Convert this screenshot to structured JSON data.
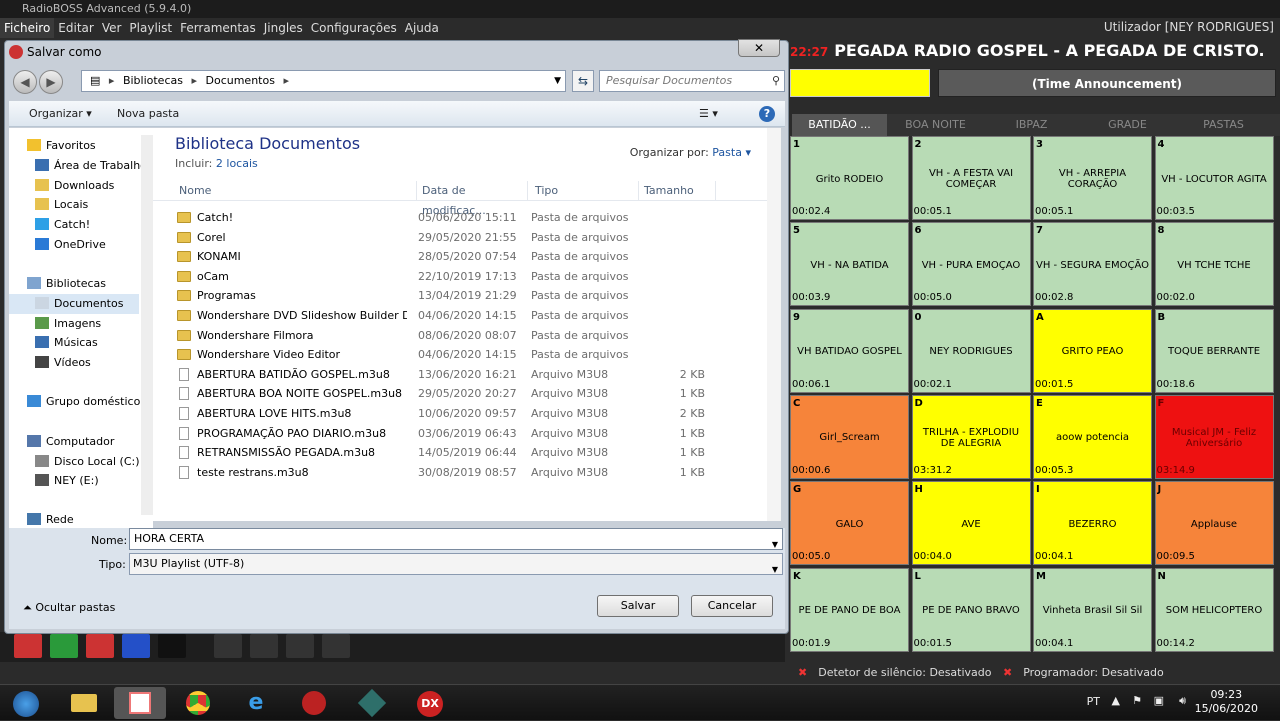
{
  "app": {
    "title": "RadioBOSS Advanced (5.9.4.0)",
    "user": "Utilizador [NEY RODRIGUES]",
    "menu": [
      "Ficheiro",
      "Editar",
      "Ver",
      "Playlist",
      "Ferramentas",
      "Jingles",
      "Configurações",
      "Ajuda"
    ],
    "now_time": "22:27",
    "now_playing": "PEGADA RADIO GOSPEL -  A PEGADA DE CRISTO.",
    "time_announcement": "(Time Announcement)",
    "tabs": [
      "BATIDÃO ...",
      "BOA NOITE",
      "IBPAZ",
      "GRADE",
      "PASTAS"
    ],
    "status": [
      "Detetor de silêncio: Desativado",
      "Programador: Desativado"
    ]
  },
  "jingles": [
    {
      "key": "1",
      "title": "Grito RODEIO",
      "dur": "00:02.4",
      "color": "#b8dbb5"
    },
    {
      "key": "2",
      "title": "VH - A FESTA VAI COMEÇAR",
      "dur": "00:05.1",
      "color": "#b8dbb5"
    },
    {
      "key": "3",
      "title": "VH - ARREPIA CORAÇÃO",
      "dur": "00:05.1",
      "color": "#b8dbb5"
    },
    {
      "key": "4",
      "title": "VH - LOCUTOR AGITA",
      "dur": "00:03.5",
      "color": "#b8dbb5"
    },
    {
      "key": "5",
      "title": "VH - NA BATIDA",
      "dur": "00:03.9",
      "color": "#b8dbb5"
    },
    {
      "key": "6",
      "title": "VH - PURA EMOÇAO",
      "dur": "00:05.0",
      "color": "#b8dbb5"
    },
    {
      "key": "7",
      "title": "VH - SEGURA EMOÇÃO",
      "dur": "00:02.8",
      "color": "#b8dbb5"
    },
    {
      "key": "8",
      "title": "VH TCHE TCHE",
      "dur": "00:02.0",
      "color": "#b8dbb5"
    },
    {
      "key": "9",
      "title": "VH BATIDAO GOSPEL",
      "dur": "00:06.1",
      "color": "#b8dbb5"
    },
    {
      "key": "0",
      "title": "NEY RODRIGUES",
      "dur": "00:02.1",
      "color": "#b8dbb5"
    },
    {
      "key": "A",
      "title": "GRITO PEAO",
      "dur": "00:01.5",
      "color": "#ffff00"
    },
    {
      "key": "B",
      "title": "TOQUE BERRANTE",
      "dur": "00:18.6",
      "color": "#b8dbb5"
    },
    {
      "key": "C",
      "title": "Girl_Scream",
      "dur": "00:00.6",
      "color": "#f6843a"
    },
    {
      "key": "D",
      "title": "TRILHA - EXPLODIU DE ALEGRIA",
      "dur": "03:31.2",
      "color": "#ffff00"
    },
    {
      "key": "E",
      "title": "aoow potencia",
      "dur": "00:05.3",
      "color": "#ffff00"
    },
    {
      "key": "F",
      "title": "Musical JM - Feliz Aniversário",
      "dur": "03:14.9",
      "color": "#ee1111"
    },
    {
      "key": "G",
      "title": "GALO",
      "dur": "00:05.0",
      "color": "#f6843a"
    },
    {
      "key": "H",
      "title": "AVE",
      "dur": "00:04.0",
      "color": "#ffff00"
    },
    {
      "key": "I",
      "title": "BEZERRO",
      "dur": "00:04.1",
      "color": "#ffff00"
    },
    {
      "key": "J",
      "title": "Applause",
      "dur": "00:09.5",
      "color": "#f6843a"
    },
    {
      "key": "K",
      "title": "PE DE PANO DE BOA",
      "dur": "00:01.9",
      "color": "#b8dbb5"
    },
    {
      "key": "L",
      "title": "PE DE PANO BRAVO",
      "dur": "00:01.5",
      "color": "#b8dbb5"
    },
    {
      "key": "M",
      "title": "Vinheta Brasil Sil Sil",
      "dur": "00:04.1",
      "color": "#b8dbb5"
    },
    {
      "key": "N",
      "title": "SOM HELICOPTERO",
      "dur": "00:14.2",
      "color": "#b8dbb5"
    }
  ],
  "dialog": {
    "title": "Salvar como",
    "address": [
      "Bibliotecas",
      "Documentos"
    ],
    "search_placeholder": "Pesquisar Documentos",
    "organize": "Organizar",
    "new_folder": "Nova pasta",
    "nav": [
      {
        "label": "Favoritos",
        "icon": "star-icon"
      },
      {
        "label": "Área de Trabalho",
        "icon": "desktop-icon"
      },
      {
        "label": "Downloads",
        "icon": "folder-icon"
      },
      {
        "label": "Locais",
        "icon": "folder-icon"
      },
      {
        "label": "Catch!",
        "icon": "catch-icon"
      },
      {
        "label": "OneDrive",
        "icon": "cloud-icon"
      },
      {
        "label": "Bibliotecas",
        "icon": "library-icon"
      },
      {
        "label": "Documentos",
        "icon": "document-icon"
      },
      {
        "label": "Imagens",
        "icon": "image-icon"
      },
      {
        "label": "Músicas",
        "icon": "music-icon"
      },
      {
        "label": "Vídeos",
        "icon": "video-icon"
      },
      {
        "label": "Grupo doméstico",
        "icon": "homegroup-icon"
      },
      {
        "label": "Computador",
        "icon": "computer-icon"
      },
      {
        "label": "Disco Local (C:)",
        "icon": "drive-icon"
      },
      {
        "label": "NEY (E:)",
        "icon": "usb-drive-icon"
      },
      {
        "label": "Rede",
        "icon": "network-icon"
      }
    ],
    "library_title": "Biblioteca Documentos",
    "library_include": "Incluir:",
    "library_locations": "2 locais",
    "arrange_label": "Organizar por:",
    "arrange_value": "Pasta",
    "columns": [
      "Nome",
      "Data de modificaç...",
      "Tipo",
      "Tamanho"
    ],
    "files": [
      {
        "name": "Catch!",
        "date": "05/06/2020 15:11",
        "type": "Pasta de arquivos",
        "size": "",
        "folder": true
      },
      {
        "name": "Corel",
        "date": "29/05/2020 21:55",
        "type": "Pasta de arquivos",
        "size": "",
        "folder": true
      },
      {
        "name": "KONAMI",
        "date": "28/05/2020 07:54",
        "type": "Pasta de arquivos",
        "size": "",
        "folder": true
      },
      {
        "name": "oCam",
        "date": "22/10/2019 17:13",
        "type": "Pasta de arquivos",
        "size": "",
        "folder": true
      },
      {
        "name": "Programas",
        "date": "13/04/2019 21:29",
        "type": "Pasta de arquivos",
        "size": "",
        "folder": true
      },
      {
        "name": "Wondershare DVD Slideshow Builder Del...",
        "date": "04/06/2020 14:15",
        "type": "Pasta de arquivos",
        "size": "",
        "folder": true
      },
      {
        "name": "Wondershare Filmora",
        "date": "08/06/2020 08:07",
        "type": "Pasta de arquivos",
        "size": "",
        "folder": true
      },
      {
        "name": "Wondershare Video Editor",
        "date": "04/06/2020 14:15",
        "type": "Pasta de arquivos",
        "size": "",
        "folder": true
      },
      {
        "name": "ABERTURA BATIDÃO GOSPEL.m3u8",
        "date": "13/06/2020 16:21",
        "type": "Arquivo M3U8",
        "size": "2 KB",
        "folder": false
      },
      {
        "name": "ABERTURA BOA NOITE GOSPEL.m3u8",
        "date": "29/05/2020 20:27",
        "type": "Arquivo M3U8",
        "size": "1 KB",
        "folder": false
      },
      {
        "name": "ABERTURA LOVE HITS.m3u8",
        "date": "10/06/2020 09:57",
        "type": "Arquivo M3U8",
        "size": "2 KB",
        "folder": false
      },
      {
        "name": "PROGRAMAÇÃO PAO DIARIO.m3u8",
        "date": "03/06/2019 06:43",
        "type": "Arquivo M3U8",
        "size": "1 KB",
        "folder": false
      },
      {
        "name": "RETRANSMISSÃO PEGADA.m3u8",
        "date": "14/05/2019 06:44",
        "type": "Arquivo M3U8",
        "size": "1 KB",
        "folder": false
      },
      {
        "name": "teste restrans.m3u8",
        "date": "30/08/2019 08:57",
        "type": "Arquivo M3U8",
        "size": "1 KB",
        "folder": false
      }
    ],
    "name_label": "Nome:",
    "name_value": "HORA CERTA",
    "type_label": "Tipo:",
    "type_value": "M3U Playlist (UTF-8)",
    "hide_folders": "Ocultar pastas",
    "save": "Salvar",
    "cancel": "Cancelar"
  },
  "taskbar": {
    "lang": "PT",
    "time": "09:23",
    "date": "15/06/2020"
  }
}
